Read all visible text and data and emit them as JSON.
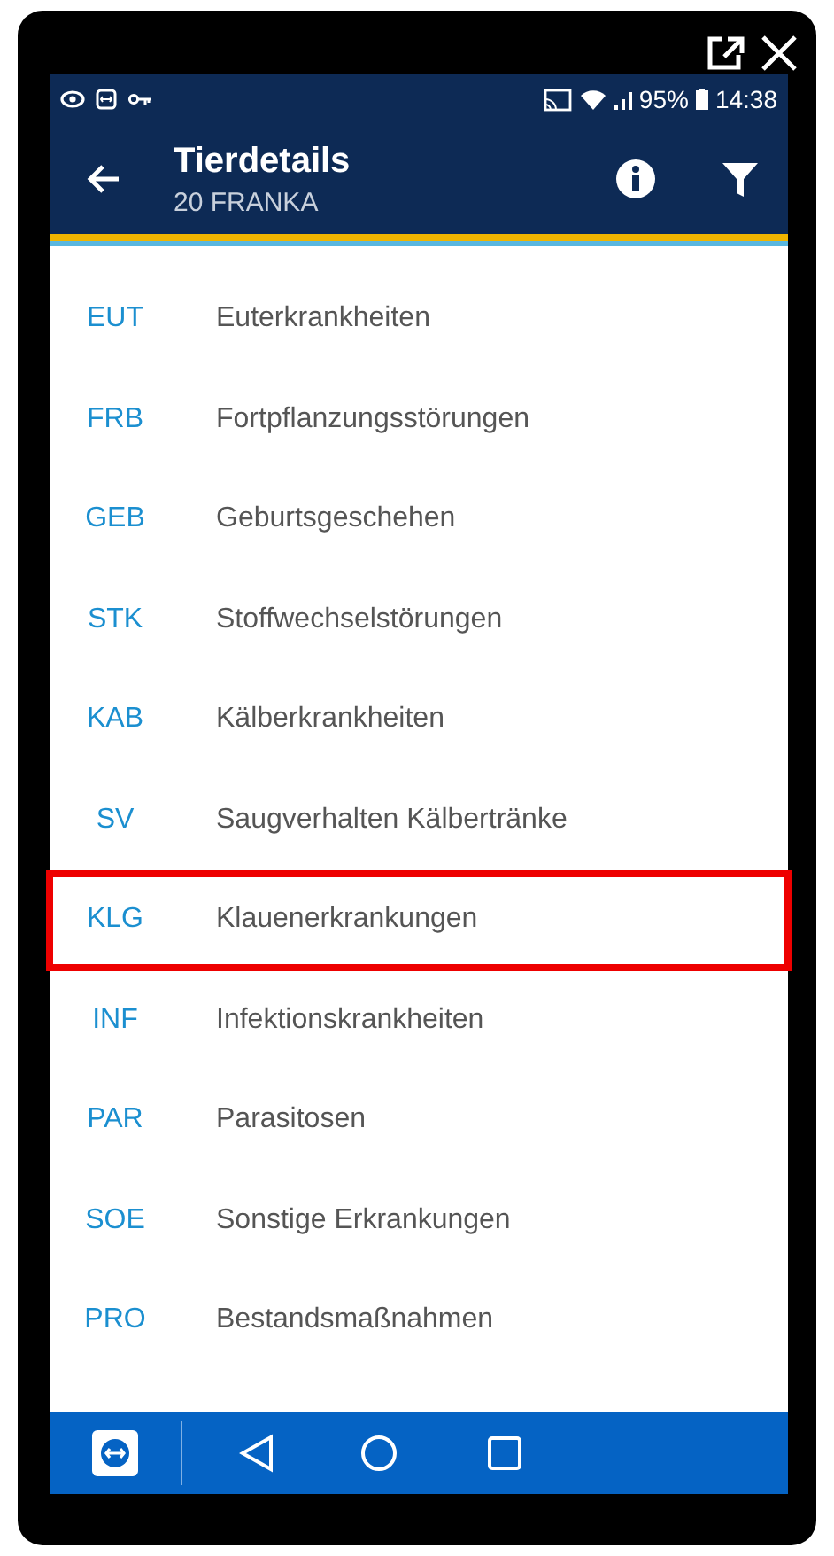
{
  "status_bar": {
    "battery": "95%",
    "time": "14:38"
  },
  "app_bar": {
    "title": "Tierdetails",
    "subtitle": "20 FRANKA"
  },
  "items": [
    {
      "code": "EUT",
      "label": "Euterkrankheiten",
      "selected": false
    },
    {
      "code": "FRB",
      "label": "Fortpflanzungsstörungen",
      "selected": false
    },
    {
      "code": "GEB",
      "label": "Geburtsgeschehen",
      "selected": false
    },
    {
      "code": "STK",
      "label": "Stoffwechselstörungen",
      "selected": false
    },
    {
      "code": "KAB",
      "label": "Kälberkrankheiten",
      "selected": false
    },
    {
      "code": "SV",
      "label": "Saugverhalten Kälbertränke",
      "selected": false
    },
    {
      "code": "KLG",
      "label": "Klauenerkrankungen",
      "selected": true
    },
    {
      "code": "INF",
      "label": "Infektionskrankheiten",
      "selected": false
    },
    {
      "code": "PAR",
      "label": "Parasitosen",
      "selected": false
    },
    {
      "code": "SOE",
      "label": "Sonstige Erkrankungen",
      "selected": false
    },
    {
      "code": "PRO",
      "label": "Bestandsmaßnahmen",
      "selected": false
    }
  ]
}
